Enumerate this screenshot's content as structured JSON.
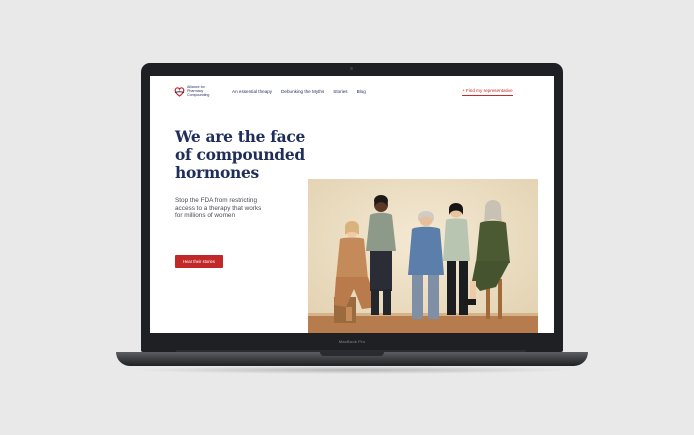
{
  "device": {
    "model_label": "MacBook Pro"
  },
  "site": {
    "logo_lines": [
      "Alliance for",
      "Pharmacy",
      "Compounding"
    ],
    "nav_links": [
      "An essential theapy",
      "Debunking the Myths",
      "Stories",
      "Blog"
    ],
    "find_rep_label": "+ Find my representative",
    "headline_lines": [
      "We are the face",
      "of compounded",
      "hormones"
    ],
    "subhead_lines": [
      "Stop the FDA from restricting",
      "access to a therapy that works",
      "for millions of women"
    ],
    "cta_label": "Hear their stories"
  },
  "colors": {
    "navy": "#1e2d5a",
    "accent_red": "#c62a2a",
    "page_bg": "#e9e9ea"
  }
}
